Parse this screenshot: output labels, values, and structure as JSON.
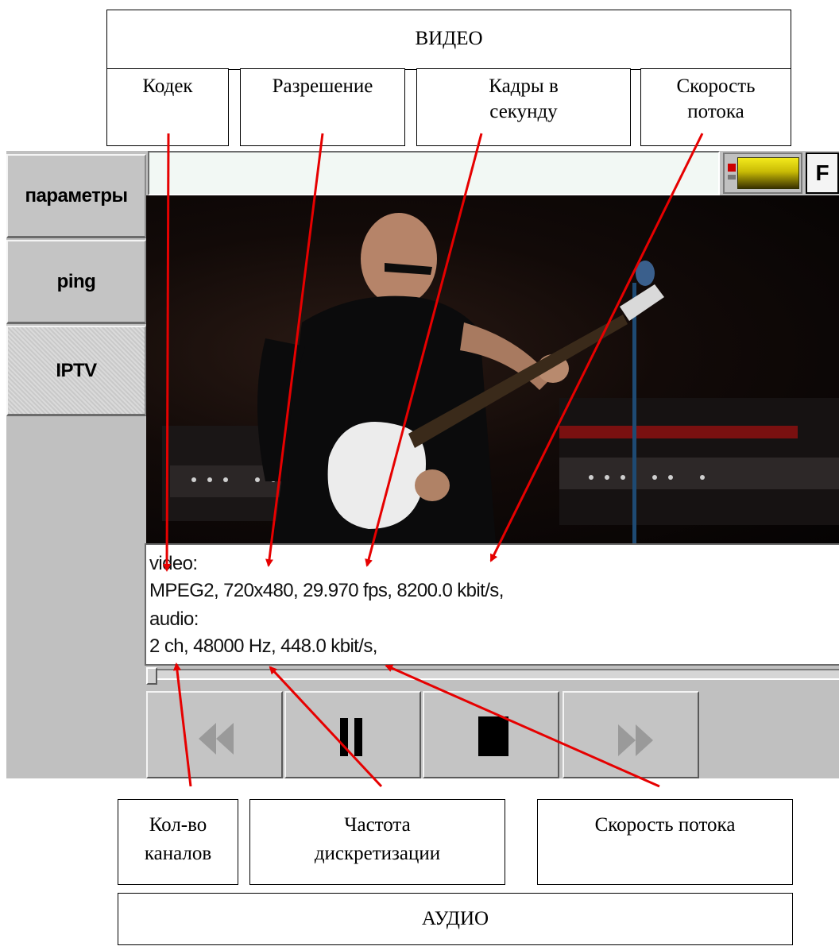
{
  "video_group": {
    "title": "ВИДЕО",
    "labels": {
      "codec": "Кодек",
      "resolution": "Разрешение",
      "fps_line1": "Кадры в",
      "fps_line2": "секунду",
      "bitrate_line1": "Скорость",
      "bitrate_line2": "потока"
    }
  },
  "audio_group": {
    "title": "АУДИО",
    "labels": {
      "channels_line1": "Кол-во",
      "channels_line2": "каналов",
      "sample_rate_line1": "Частота",
      "sample_rate_line2": "дискретизации",
      "bitrate": "Скорость потока"
    }
  },
  "sidebar": {
    "tabs": [
      {
        "label": "параметры",
        "active": false
      },
      {
        "label": "ping",
        "active": false
      },
      {
        "label": "IPTV",
        "active": true
      }
    ]
  },
  "toolbar": {
    "f_label": "F"
  },
  "stream_info": {
    "video_header": "video:",
    "video_details": "MPEG2, 720x480, 29.970 fps, 8200.0 kbit/s,",
    "audio_header": "audio:",
    "audio_details": "2 ch, 48000 Hz, 448.0 kbit/s,"
  },
  "player": {
    "position_fraction": 0.0,
    "buttons": [
      {
        "icon": "rewind-icon",
        "enabled": false
      },
      {
        "icon": "pause-icon",
        "enabled": true
      },
      {
        "icon": "stop-icon",
        "enabled": true
      },
      {
        "icon": "fast-forward-icon",
        "enabled": false
      }
    ]
  },
  "colors": {
    "arrow": "#e60000",
    "level_meter": "#d8cc10"
  }
}
